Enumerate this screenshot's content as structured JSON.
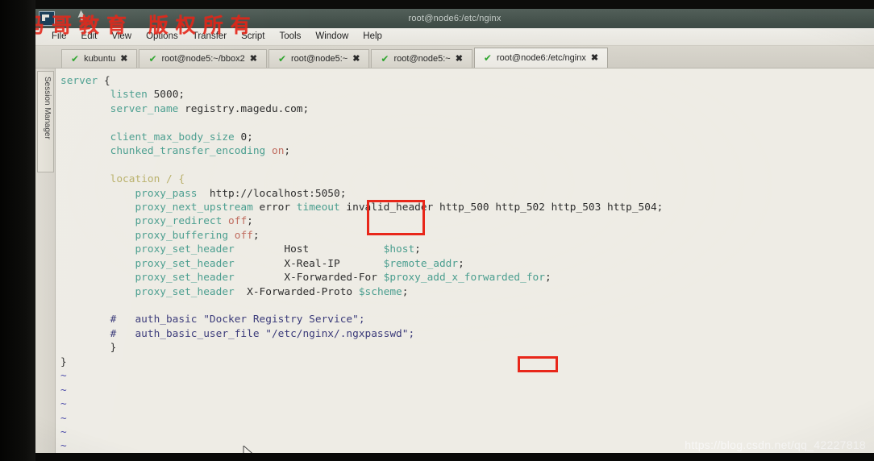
{
  "window": {
    "title": "root@node6:/etc/nginx",
    "icon": "securecrt-window-icon"
  },
  "menubar": {
    "items": [
      {
        "label": "File"
      },
      {
        "label": "Edit"
      },
      {
        "label": "View"
      },
      {
        "label": "Options"
      },
      {
        "label": "Transfer"
      },
      {
        "label": "Script"
      },
      {
        "label": "Tools"
      },
      {
        "label": "Window"
      },
      {
        "label": "Help"
      }
    ]
  },
  "watermarks": {
    "chinese": "马哥教育 版权所有",
    "url": "https://blog.csdn.net/qq_42227818"
  },
  "sidebar": {
    "session_manager_label": "Session Manager"
  },
  "tabs": [
    {
      "label": "kubuntu",
      "active": false,
      "status_icon": "green-check-icon",
      "close_icon": "close-x-icon"
    },
    {
      "label": "root@node5:~/bbox2",
      "active": false,
      "status_icon": "green-check-icon",
      "close_icon": "close-x-icon"
    },
    {
      "label": "root@node5:~",
      "active": false,
      "status_icon": "green-check-icon",
      "close_icon": "close-x-icon"
    },
    {
      "label": "root@node5:~",
      "active": false,
      "status_icon": "green-check-icon",
      "close_icon": "close-x-icon"
    },
    {
      "label": "root@node6:/etc/nginx",
      "active": true,
      "status_icon": "green-check-icon",
      "close_icon": "close-x-icon"
    }
  ],
  "terminal": {
    "code_lines": [
      "server {",
      "        listen 5000;",
      "        server_name registry.magedu.com;",
      "",
      "        client_max_body_size 0;",
      "        chunked_transfer_encoding on;",
      "",
      "        location / {",
      "            proxy_pass  http://localhost:5050;",
      "            proxy_next_upstream error timeout invalid_header http_500 http_502 http_503 http_504;",
      "            proxy_redirect off;",
      "            proxy_buffering off;",
      "            proxy_set_header        Host            $host;",
      "            proxy_set_header        X-Real-IP       $remote_addr;",
      "            proxy_set_header        X-Forwarded-For $proxy_add_x_forwarded_for;",
      "            proxy_set_header  X-Forwarded-Proto $scheme;",
      "",
      "        #   auth_basic \"Docker Registry Service\";",
      "        #   auth_basic_user_file \"/etc/nginx/.ngxpasswd\";",
      "        }",
      "}"
    ],
    "empty_line_markers": [
      "~",
      "~",
      "~",
      "~",
      "~",
      "~",
      "~"
    ],
    "cursor": "mouse-pointer"
  },
  "annotations": [
    {
      "name": "red-box-1",
      "note": ""
    },
    {
      "name": "red-box-2",
      "note": ""
    }
  ],
  "colors": {
    "directive": "#4a9e8f",
    "location_keyword": "#b9b06a",
    "value": "#c06b5e",
    "comment": "#3b3b7a",
    "annotation": "#e8271a",
    "terminal_bg": "#eeece5"
  }
}
